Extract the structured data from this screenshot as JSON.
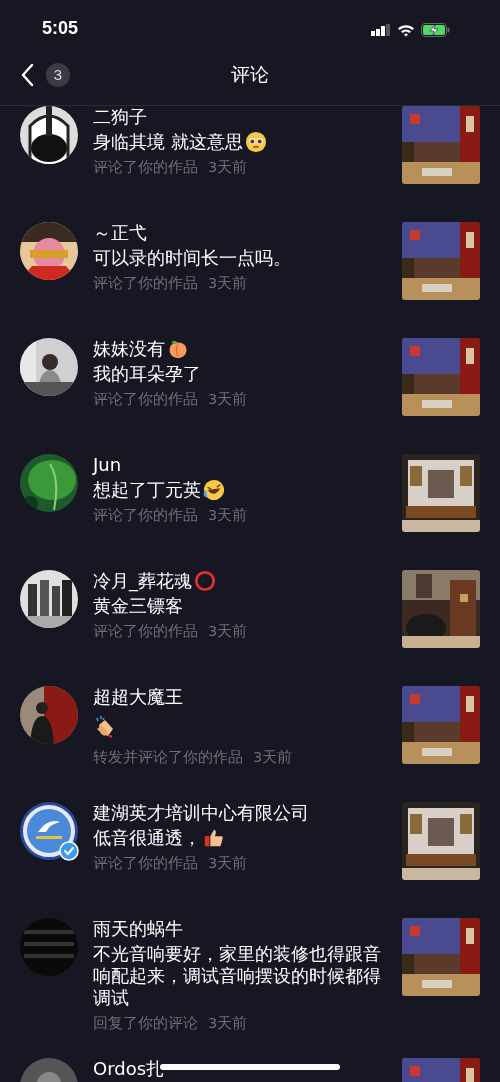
{
  "status_bar": {
    "time": "5:05"
  },
  "nav": {
    "back_count": "3",
    "title": "评论"
  },
  "comments": [
    {
      "name": "二狗子",
      "text": "身临其境 就这意思",
      "emoji": {
        "kind": "pleading"
      },
      "action": "评论了你的作品",
      "time": "3天前",
      "verified": false
    },
    {
      "name": "～正弋",
      "text": "可以录的时间长一点吗。",
      "action": "评论了你的作品",
      "time": "3天前",
      "verified": false
    },
    {
      "name": "妹妹没有",
      "name_emoji": {
        "kind": "peach"
      },
      "text": "我的耳朵孕了",
      "action": "评论了你的作品",
      "time": "3天前",
      "verified": false
    },
    {
      "name": "Jun",
      "text": "想起了丁元英",
      "emoji": {
        "kind": "laughing"
      },
      "action": "评论了你的作品",
      "time": "3天前",
      "verified": false
    },
    {
      "name": "冷月_葬花魂",
      "name_emoji": {
        "kind": "ring"
      },
      "text": "黄金三镖客",
      "action": "评论了你的作品",
      "time": "3天前",
      "verified": false
    },
    {
      "name": "超超大魔王",
      "emoji": {
        "kind": "clap"
      },
      "action": "转发并评论了你的作品",
      "time": "3天前",
      "verified": false
    },
    {
      "name": "建湖英才培训中心有限公司",
      "text": "低音很通透，",
      "emoji": {
        "kind": "thumb"
      },
      "action": "评论了你的作品",
      "time": "3天前",
      "verified": true
    },
    {
      "name": "雨天的蜗牛",
      "text": "不光音响要好，家里的装修也得跟音响配起来，调试音响摆设的时候都得调试",
      "action": "回复了你的评论",
      "time": "3天前",
      "verified": false
    },
    {
      "name": "Ordos扎"
    }
  ]
}
